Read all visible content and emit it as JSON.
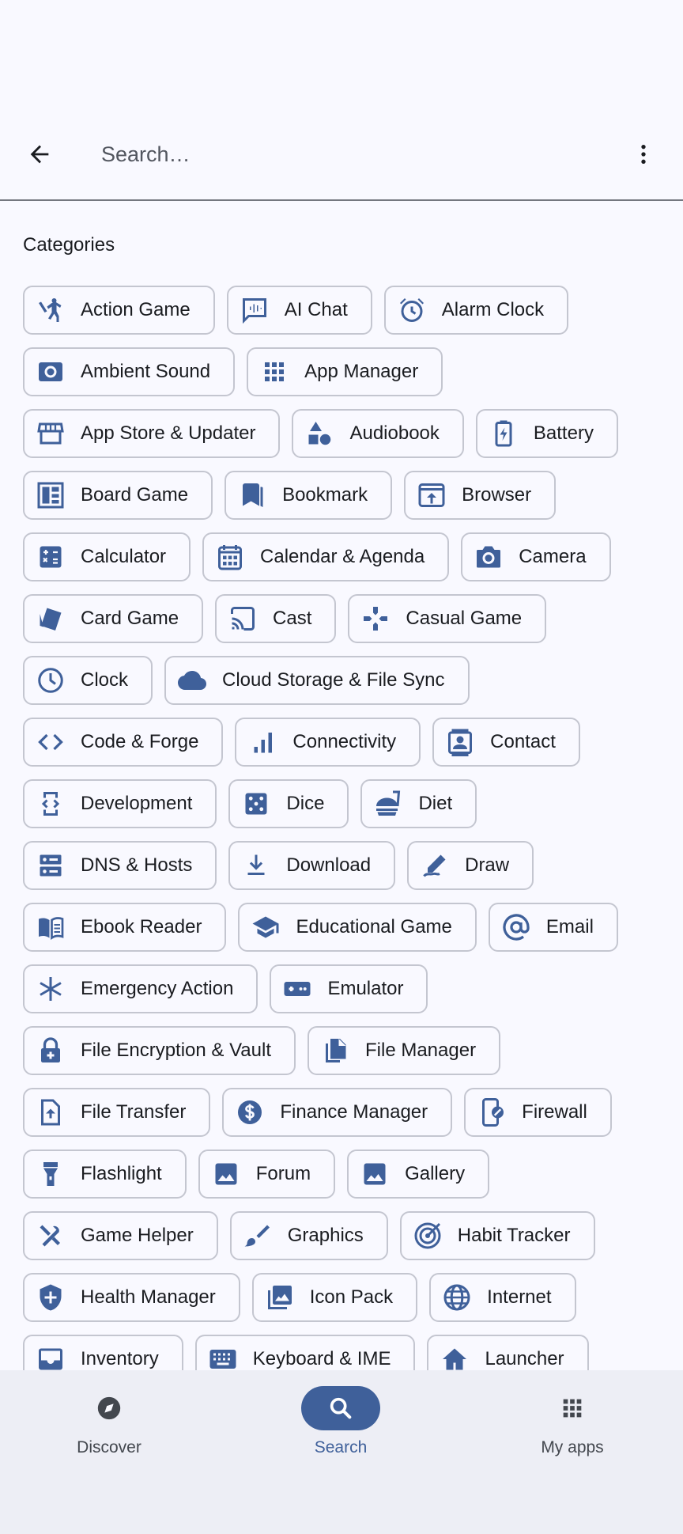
{
  "search": {
    "placeholder": "Search…"
  },
  "categories_title": "Categories",
  "icon_color": "#3f609a",
  "categories": [
    {
      "label": "Action Game",
      "icon": "sprint-icon"
    },
    {
      "label": "AI Chat",
      "icon": "voice-chat-icon"
    },
    {
      "label": "Alarm Clock",
      "icon": "alarm-clock-icon"
    },
    {
      "label": "Ambient Sound",
      "icon": "ambient-sound-icon"
    },
    {
      "label": "App Manager",
      "icon": "apps-grid-icon"
    },
    {
      "label": "App Store & Updater",
      "icon": "storefront-icon"
    },
    {
      "label": "Audiobook",
      "icon": "shapes-icon"
    },
    {
      "label": "Battery",
      "icon": "battery-icon"
    },
    {
      "label": "Board Game",
      "icon": "board-game-icon"
    },
    {
      "label": "Bookmark",
      "icon": "bookmarks-icon"
    },
    {
      "label": "Browser",
      "icon": "browser-icon"
    },
    {
      "label": "Calculator",
      "icon": "calculator-icon"
    },
    {
      "label": "Calendar & Agenda",
      "icon": "calendar-icon"
    },
    {
      "label": "Camera",
      "icon": "camera-icon"
    },
    {
      "label": "Card Game",
      "icon": "cards-icon"
    },
    {
      "label": "Cast",
      "icon": "cast-icon"
    },
    {
      "label": "Casual Game",
      "icon": "gamepad-icon"
    },
    {
      "label": "Clock",
      "icon": "clock-icon"
    },
    {
      "label": "Cloud Storage & File Sync",
      "icon": "cloud-icon"
    },
    {
      "label": "Code & Forge",
      "icon": "code-icon"
    },
    {
      "label": "Connectivity",
      "icon": "signal-bars-icon"
    },
    {
      "label": "Contact",
      "icon": "contact-icon"
    },
    {
      "label": "Development",
      "icon": "developer-mode-icon"
    },
    {
      "label": "Dice",
      "icon": "dice-icon"
    },
    {
      "label": "Diet",
      "icon": "diet-icon"
    },
    {
      "label": "DNS & Hosts",
      "icon": "dns-icon"
    },
    {
      "label": "Download",
      "icon": "download-icon"
    },
    {
      "label": "Draw",
      "icon": "draw-icon"
    },
    {
      "label": "Ebook Reader",
      "icon": "book-icon"
    },
    {
      "label": "Educational Game",
      "icon": "school-icon"
    },
    {
      "label": "Email",
      "icon": "at-sign-icon"
    },
    {
      "label": "Emergency Action",
      "icon": "asterisk-icon"
    },
    {
      "label": "Emulator",
      "icon": "emulator-icon"
    },
    {
      "label": "File Encryption & Vault",
      "icon": "lock-icon"
    },
    {
      "label": "File Manager",
      "icon": "files-icon"
    },
    {
      "label": "File Transfer",
      "icon": "file-upload-icon"
    },
    {
      "label": "Finance Manager",
      "icon": "dollar-icon"
    },
    {
      "label": "Firewall",
      "icon": "phone-block-icon"
    },
    {
      "label": "Flashlight",
      "icon": "flashlight-icon"
    },
    {
      "label": "Forum",
      "icon": "image-icon"
    },
    {
      "label": "Gallery",
      "icon": "image-icon"
    },
    {
      "label": "Game Helper",
      "icon": "tools-icon"
    },
    {
      "label": "Graphics",
      "icon": "brush-icon"
    },
    {
      "label": "Habit Tracker",
      "icon": "target-icon"
    },
    {
      "label": "Health Manager",
      "icon": "health-shield-icon"
    },
    {
      "label": "Icon Pack",
      "icon": "photo-library-icon"
    },
    {
      "label": "Internet",
      "icon": "globe-icon"
    },
    {
      "label": "Inventory",
      "icon": "inbox-icon"
    },
    {
      "label": "Keyboard & IME",
      "icon": "keyboard-icon"
    },
    {
      "label": "Launcher",
      "icon": "home-icon"
    }
  ],
  "bottom_nav": [
    {
      "label": "Discover",
      "icon": "compass-icon",
      "active": false
    },
    {
      "label": "Search",
      "icon": "search-icon",
      "active": true
    },
    {
      "label": "My apps",
      "icon": "apps-grid-icon",
      "active": false
    }
  ]
}
